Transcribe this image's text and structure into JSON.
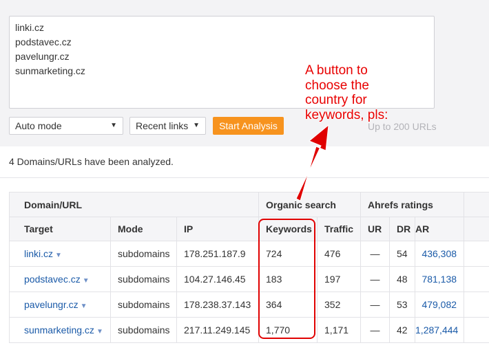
{
  "input": {
    "urls": [
      "linki.cz",
      "podstavec.cz",
      "pavelungr.cz",
      "sunmarketing.cz"
    ]
  },
  "controls": {
    "mode_value": "Auto mode",
    "recent_value": "Recent links",
    "start_label": "Start Analysis",
    "limit_note": "Up to 200 URLs"
  },
  "status": {
    "message": "4 Domains/URLs have been analyzed."
  },
  "table": {
    "groups": {
      "domain": "Domain/URL",
      "organic": "Organic search",
      "ahrefs": "Ahrefs ratings"
    },
    "columns": {
      "target": "Target",
      "mode": "Mode",
      "ip": "IP",
      "keywords": "Keywords",
      "traffic": "Traffic",
      "ur": "UR",
      "dr": "DR",
      "ar": "AR"
    },
    "rows": [
      {
        "target": "linki.cz",
        "mode": "subdomains",
        "ip": "178.251.187.9",
        "keywords": "724",
        "traffic": "476",
        "ur": "—",
        "dr": "54",
        "ar": "436,308"
      },
      {
        "target": "podstavec.cz",
        "mode": "subdomains",
        "ip": "104.27.146.45",
        "keywords": "183",
        "traffic": "197",
        "ur": "—",
        "dr": "48",
        "ar": "781,138"
      },
      {
        "target": "pavelungr.cz",
        "mode": "subdomains",
        "ip": "178.238.37.143",
        "keywords": "364",
        "traffic": "352",
        "ur": "—",
        "dr": "53",
        "ar": "479,082"
      },
      {
        "target": "sunmarketing.cz",
        "mode": "subdomains",
        "ip": "217.11.249.145",
        "keywords": "1,770",
        "traffic": "1,171",
        "ur": "—",
        "dr": "42",
        "ar": "1,287,444"
      }
    ]
  },
  "annotation": {
    "lines": [
      "A button to",
      "choose the",
      "country for",
      "keywords, pls:"
    ],
    "color": "#e80000"
  },
  "colors": {
    "accent_button": "#f7931e",
    "link": "#1a5aa8",
    "panel_bg": "#f3f3f5"
  }
}
